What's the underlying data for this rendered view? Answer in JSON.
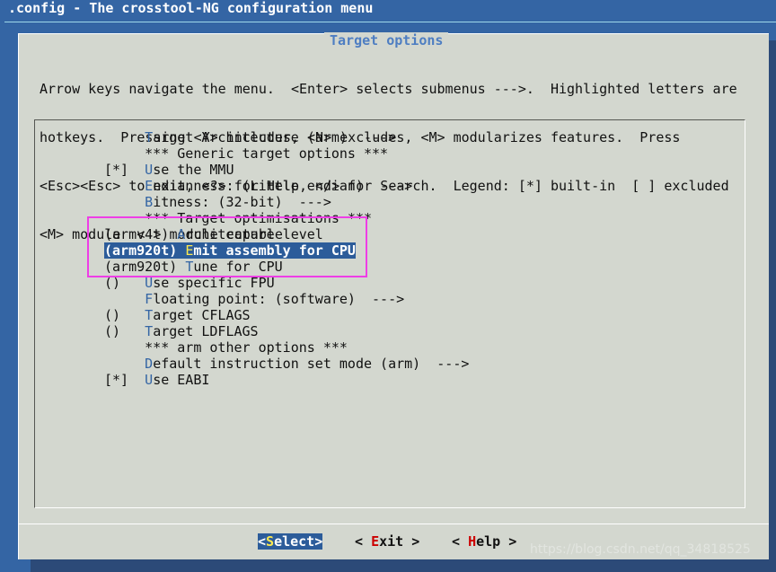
{
  "window": {
    "title": ".config - The crosstool-NG configuration menu"
  },
  "dialog": {
    "title": "Target options",
    "help_lines": [
      "Arrow keys navigate the menu.  <Enter> selects submenus --->.  Highlighted letters are",
      "hotkeys.  Pressing <Y> includes, <N> excludes, <M> modularizes features.  Press",
      "<Esc><Esc> to exit, <?> for Help, </> for Search.  Legend: [*] built-in  [ ] excluded",
      "<M> module  < > module capable"
    ]
  },
  "menu": {
    "items": [
      {
        "prefix": "     ",
        "hotkey": "T",
        "rest": "arget Architecture (arm)  --->"
      },
      {
        "prefix": "     ",
        "hotkey": "",
        "rest": "*** Generic target options ***"
      },
      {
        "prefix": "[*]  ",
        "hotkey": "U",
        "rest": "se the MMU"
      },
      {
        "prefix": "     ",
        "hotkey": "E",
        "rest": "ndianness: (Little endian)  --->"
      },
      {
        "prefix": "     ",
        "hotkey": "B",
        "rest": "itness: (32-bit)  --->"
      },
      {
        "prefix": "     ",
        "hotkey": "",
        "rest": "*** Target optimisations ***"
      },
      {
        "prefix": "(armv4t) ",
        "hotkey": "A",
        "rest": "rchitecture level"
      },
      {
        "prefix": "(arm920t) ",
        "hotkey": "E",
        "rest": "mit assembly for CPU"
      },
      {
        "prefix": "(arm920t) ",
        "hotkey": "T",
        "rest": "une for CPU"
      },
      {
        "prefix": "()   ",
        "hotkey": "U",
        "rest": "se specific FPU"
      },
      {
        "prefix": "     ",
        "hotkey": "F",
        "rest": "loating point: (software)  --->"
      },
      {
        "prefix": "()   ",
        "hotkey": "T",
        "rest": "arget CFLAGS"
      },
      {
        "prefix": "()   ",
        "hotkey": "T",
        "rest": "arget LDFLAGS"
      },
      {
        "prefix": "     ",
        "hotkey": "",
        "rest": "*** arm other options ***"
      },
      {
        "prefix": "     ",
        "hotkey": "D",
        "rest": "efault instruction set mode (arm)  --->"
      },
      {
        "prefix": "[*]  ",
        "hotkey": "U",
        "rest": "se EABI"
      }
    ],
    "selected_index": 7
  },
  "buttons": {
    "select": {
      "open": "<",
      "hotkey": "S",
      "rest": "elect>"
    },
    "exit": {
      "open": "< ",
      "hotkey": "E",
      "rest": "xit >"
    },
    "help": {
      "open": "< ",
      "hotkey": "H",
      "rest": "elp >"
    }
  },
  "watermark": "https://blog.csdn.net/qq_34818525",
  "colors": {
    "background": "#3465a4",
    "dialog": "#d3d7cf",
    "selection": "#2c5c9a",
    "hotkey": "#3465a4",
    "annotation": "#ee3ee6"
  }
}
